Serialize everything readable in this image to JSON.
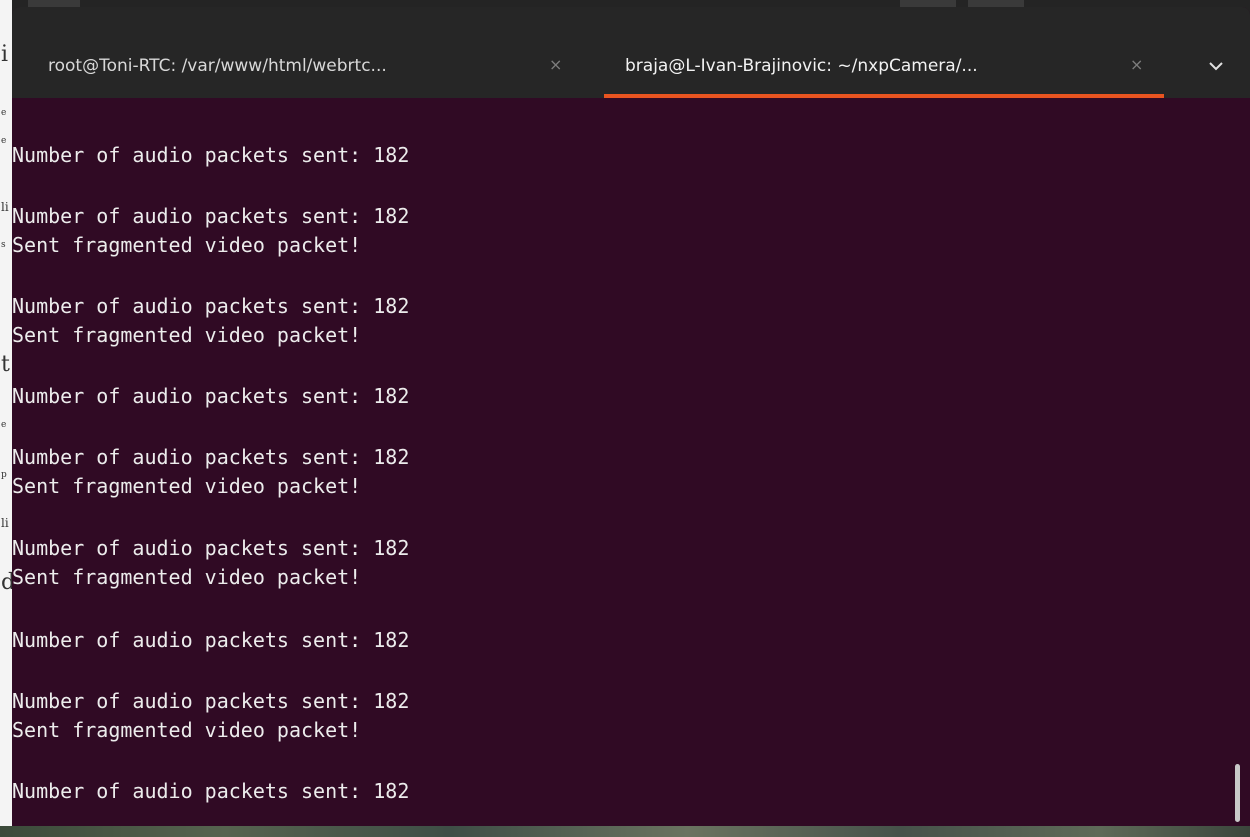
{
  "tabs": [
    {
      "title": "root@Toni-RTC: /var/www/html/webrtc...",
      "close": "×",
      "active": false
    },
    {
      "title": "braja@L-Ivan-Brajinovic: ~/nxpCamera/...",
      "close": "×",
      "active": true
    }
  ],
  "tab_menu_icon": "chevron-down-icon",
  "accent_color": "#e95420",
  "terminal_bg": "#300a24",
  "terminal_lines": [
    "Number of audio packets sent: 182",
    "Number of audio packets sent: 182",
    "Sent fragmented video packet!",
    "Number of audio packets sent: 182",
    "Sent fragmented video packet!",
    "Number of audio packets sent: 182",
    "Number of audio packets sent: 182",
    "Sent fragmented video packet!",
    "Number of audio packets sent: 182",
    "Sent fragmented video packet!",
    "Number of audio packets sent: 182",
    "Number of audio packets sent: 182",
    "Sent fragmented video packet!",
    "Number of audio packets sent: 182"
  ],
  "background_fragments": [
    "i",
    "e",
    "e",
    "li",
    "s",
    "t",
    "e",
    "p",
    "li",
    "d"
  ]
}
